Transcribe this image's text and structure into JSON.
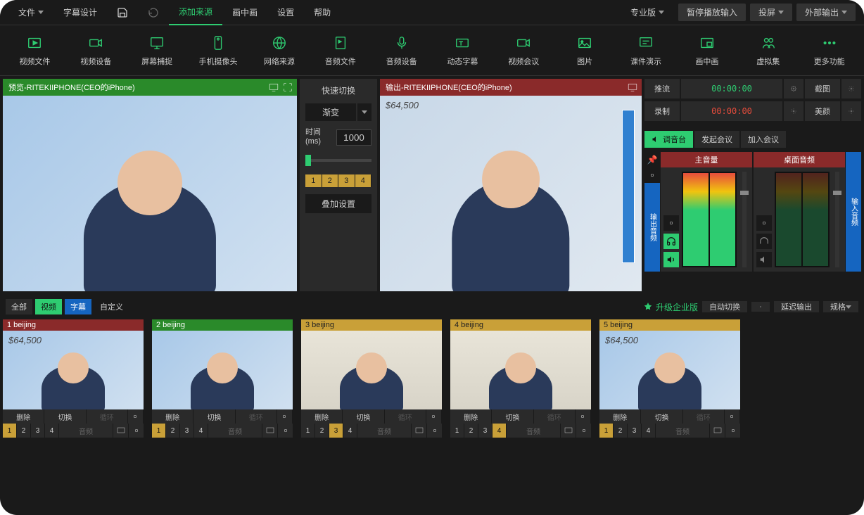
{
  "menu": {
    "file": "文件",
    "subtitle": "字幕设计",
    "add_source": "添加来源",
    "pip": "画中画",
    "settings": "设置",
    "help": "帮助",
    "edition": "专业版",
    "pause_input": "暂停播放输入",
    "cast": "投屏",
    "external_out": "外部输出"
  },
  "toolbar": [
    "视频文件",
    "视频设备",
    "屏幕捕捉",
    "手机摄像头",
    "网络来源",
    "音频文件",
    "音频设备",
    "动态字幕",
    "视频会议",
    "图片",
    "课件演示",
    "画中画",
    "虚拟集",
    "更多功能"
  ],
  "preview": {
    "title": "预览-RITEKIIPHONE(CEO的iPhone)"
  },
  "output": {
    "title": "输出-RITEKIIPHONE(CEO的iPhone)",
    "price": "$64,500"
  },
  "transition": {
    "quick": "快速切换",
    "type": "渐变",
    "time_label": "时间 (ms)",
    "time_value": "1000",
    "presets": [
      "1",
      "2",
      "3",
      "4"
    ],
    "overlay": "叠加设置"
  },
  "right": {
    "stream": "推流",
    "stream_time": "00:00:00",
    "record": "录制",
    "record_time": "00:00:00",
    "screenshot": "截图",
    "beauty": "美颜",
    "tabs": {
      "mixer": "调音台",
      "start_meeting": "发起会议",
      "join_meeting": "加入会议"
    },
    "strips": {
      "master": "主音量",
      "desktop": "桌面音频"
    },
    "side_out": "输出音频",
    "side_in": "输入音频"
  },
  "bottom": {
    "filters": {
      "all": "全部",
      "video": "视频",
      "subtitle": "字幕",
      "custom": "自定义"
    },
    "upgrade": "升级企业版",
    "auto_switch": "自动切换",
    "delay_out": "延迟输出",
    "spec": "规格"
  },
  "scenes": [
    {
      "title": "1 beijing",
      "color": "red",
      "active": 1,
      "price": "$64,500"
    },
    {
      "title": "2 beijing",
      "color": "green",
      "active": 1
    },
    {
      "title": "3 beijing",
      "color": "gold",
      "active": 3
    },
    {
      "title": "4 beijing",
      "color": "gold",
      "active": 4
    },
    {
      "title": "5 beijing",
      "color": "gold",
      "active": 1,
      "price": "$64,500"
    }
  ],
  "scene_actions": {
    "delete": "删除",
    "switch": "切换",
    "loop": "循环",
    "audio": "音频"
  }
}
